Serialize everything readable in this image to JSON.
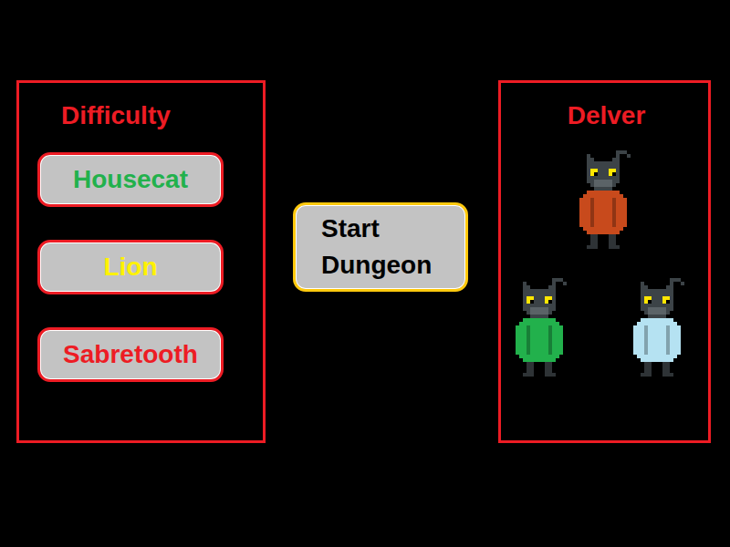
{
  "difficulty": {
    "title": "Difficulty",
    "options": [
      {
        "label": "Housecat",
        "color": "#22b14c"
      },
      {
        "label": "Lion",
        "color": "#fff200"
      },
      {
        "label": "Sabretooth",
        "color": "#ed1c24"
      }
    ]
  },
  "start_button": {
    "label": "Start Dungeon"
  },
  "delver": {
    "title": "Delver",
    "options": [
      {
        "color": "#c84a1c"
      },
      {
        "color": "#22b14c"
      },
      {
        "color": "#b5e2f2"
      }
    ]
  }
}
